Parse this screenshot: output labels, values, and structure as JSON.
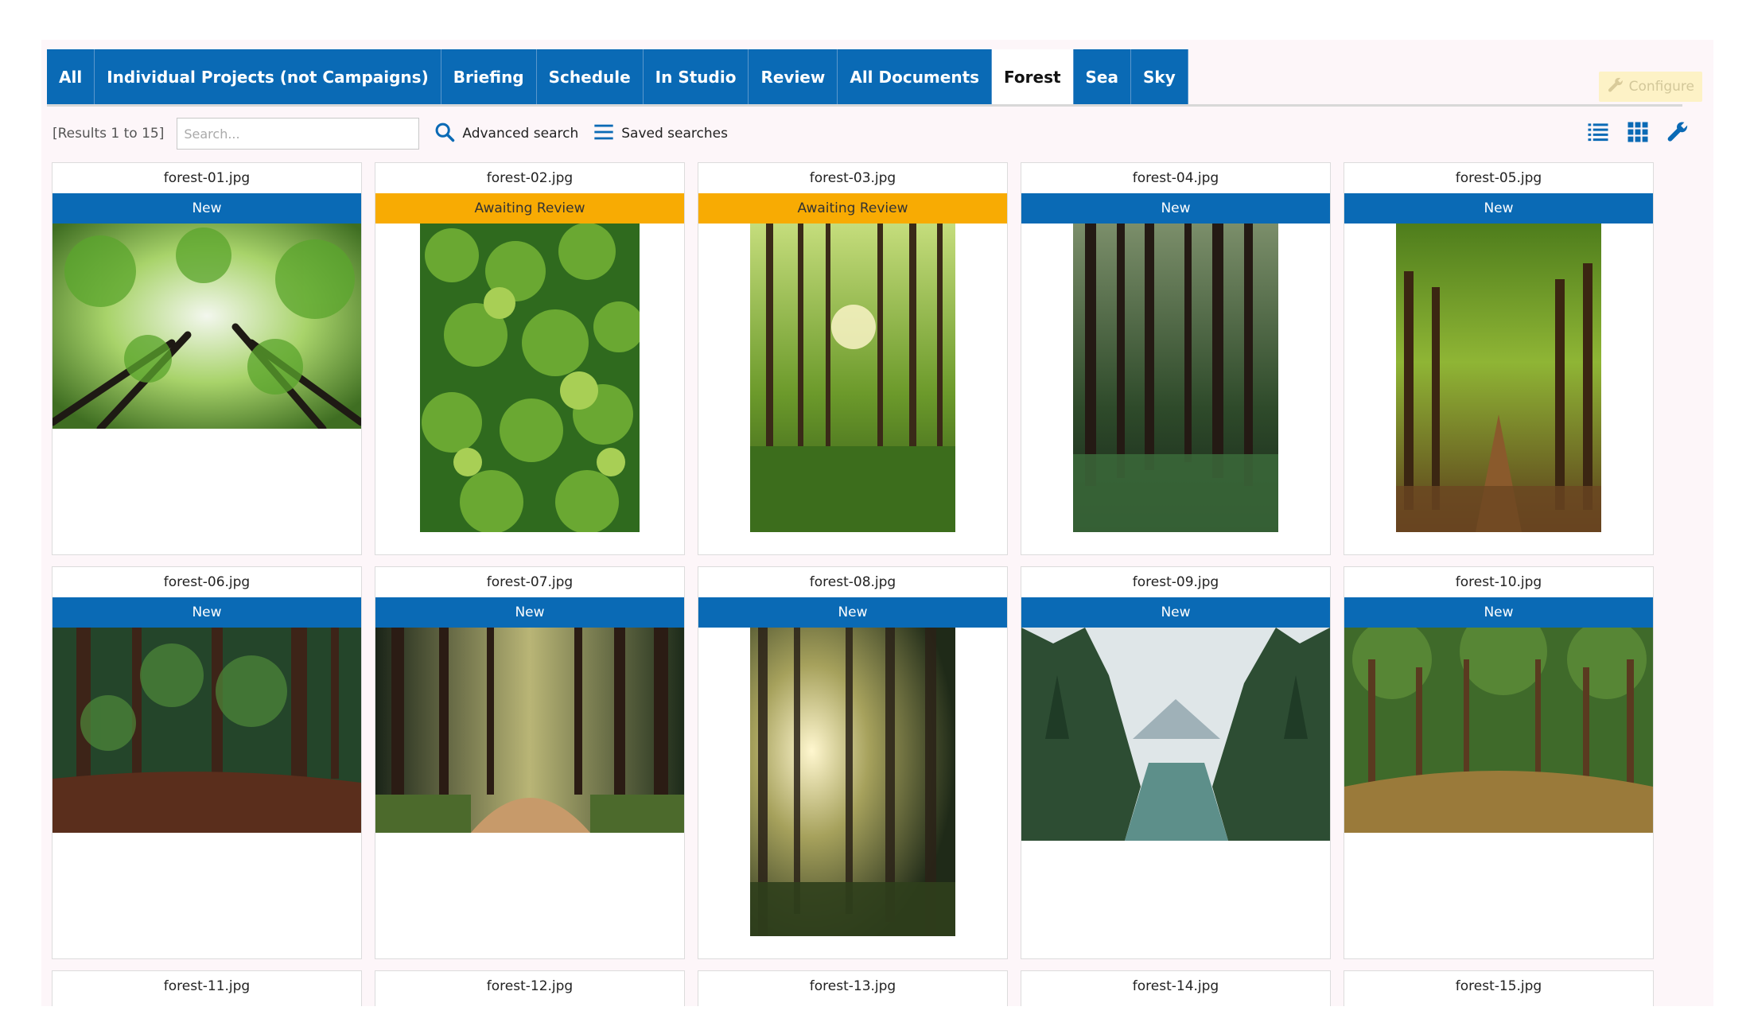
{
  "tabs": [
    {
      "label": "All",
      "active": false
    },
    {
      "label": "Individual Projects (not Campaigns)",
      "active": false
    },
    {
      "label": "Briefing",
      "active": false
    },
    {
      "label": "Schedule",
      "active": false
    },
    {
      "label": "In Studio",
      "active": false
    },
    {
      "label": "Review",
      "active": false
    },
    {
      "label": "All Documents",
      "active": false
    },
    {
      "label": "Forest",
      "active": true
    },
    {
      "label": "Sea",
      "active": false
    },
    {
      "label": "Sky",
      "active": false
    }
  ],
  "configure_label": "Configure",
  "toolbar": {
    "results_text": "[Results 1 to 15]",
    "search_placeholder": "Search...",
    "advanced_search_label": "Advanced search",
    "saved_searches_label": "Saved searches"
  },
  "colors": {
    "tab_blue": "#0a6ab5",
    "status_new": "#0a6ab5",
    "status_awaiting": "#f8ab03",
    "configure_bg": "#fdf2c6"
  },
  "icons": [
    "search-icon",
    "hamburger-icon",
    "list-view-icon",
    "grid-view-icon",
    "wrench-icon"
  ],
  "cards": [
    {
      "filename": "forest-01.jpg",
      "status": "New"
    },
    {
      "filename": "forest-02.jpg",
      "status": "Awaiting Review"
    },
    {
      "filename": "forest-03.jpg",
      "status": "Awaiting Review"
    },
    {
      "filename": "forest-04.jpg",
      "status": "New"
    },
    {
      "filename": "forest-05.jpg",
      "status": "New"
    },
    {
      "filename": "forest-06.jpg",
      "status": "New"
    },
    {
      "filename": "forest-07.jpg",
      "status": "New"
    },
    {
      "filename": "forest-08.jpg",
      "status": "New"
    },
    {
      "filename": "forest-09.jpg",
      "status": "New"
    },
    {
      "filename": "forest-10.jpg",
      "status": "New"
    },
    {
      "filename": "forest-11.jpg"
    },
    {
      "filename": "forest-12.jpg"
    },
    {
      "filename": "forest-13.jpg"
    },
    {
      "filename": "forest-14.jpg"
    },
    {
      "filename": "forest-15.jpg"
    }
  ]
}
